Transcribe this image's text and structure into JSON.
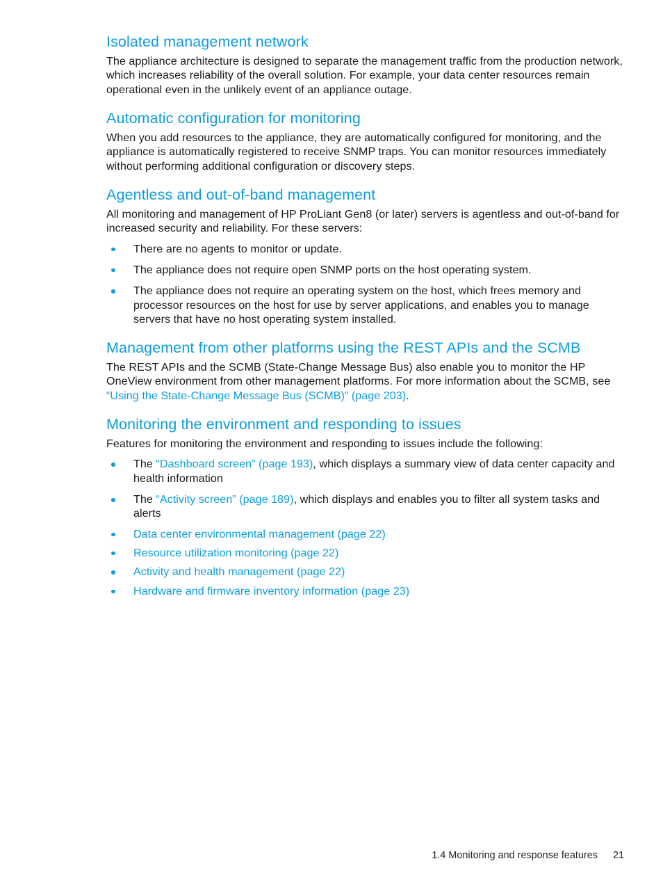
{
  "page": {
    "number": "21",
    "footer_section": "1.4 Monitoring and response features"
  },
  "colors": {
    "heading_blue": "#0d9ddb",
    "link_blue": "#0d9ddb",
    "body_black": "#1a1a1a",
    "background": "#ffffff"
  },
  "sections": [
    {
      "heading": "Isolated management network",
      "paragraph": "The appliance architecture is designed to separate the management traffic from the production network, which increases reliability of the overall solution. For example, your data center resources remain operational even in the unlikely event of an appliance outage."
    },
    {
      "heading": "Automatic configuration for monitoring",
      "paragraph": "When you add resources to the appliance, they are automatically configured for monitoring, and the appliance is automatically registered to receive SNMP traps. You can monitor resources immediately without performing additional configuration or discovery steps."
    },
    {
      "heading": "Agentless and out-of-band management",
      "paragraph": "All monitoring and management of HP ProLiant Gen8 (or later) servers is agentless and out-of-band for increased security and reliability. For these servers:",
      "bullets": [
        "There are no agents to monitor or update.",
        "The appliance does not require open SNMP ports on the host operating system.",
        "The appliance does not require an operating system on the host, which frees memory and processor resources on the host for use by server applications, and enables you to manage servers that have no host operating system installed."
      ]
    },
    {
      "heading": "Management from other platforms using the REST APIs and the SCMB",
      "paragraph_pre": "The REST APIs and the SCMB (State-Change Message Bus) also enable you to monitor the HP OneView environment from other management platforms. For more information about the SCMB, see ",
      "paragraph_link": "“Using the State-Change Message Bus (SCMB)” (page 203)",
      "paragraph_post": "."
    },
    {
      "heading": "Monitoring the environment and responding to issues",
      "paragraph": "Features for monitoring the environment and responding to issues include the following:",
      "rich_bullets": [
        {
          "pre": "The ",
          "link": "“Dashboard screen” (page 193)",
          "post": ", which displays a summary view of data center capacity and health information"
        },
        {
          "pre": "The ",
          "link": "“Activity screen” (page 189)",
          "post": ", which displays and enables you to filter all system tasks and alerts"
        }
      ],
      "link_bullets": [
        "Data center environmental management (page 22)",
        "Resource utilization monitoring (page 22)",
        "Activity and health management (page 22)",
        "Hardware and firmware inventory information (page 23)"
      ]
    }
  ]
}
